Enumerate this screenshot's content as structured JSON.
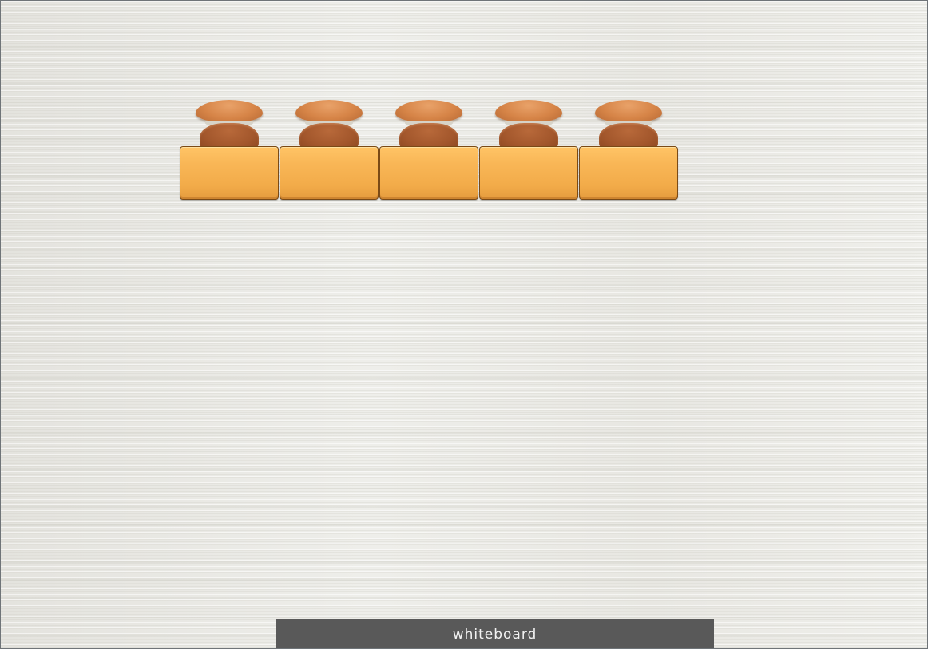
{
  "room": {
    "whiteboard_label": "whiteboard",
    "stations": [
      {
        "item": "desk-with-chair"
      },
      {
        "item": "desk-with-chair"
      },
      {
        "item": "desk-with-chair"
      },
      {
        "item": "desk-with-chair"
      },
      {
        "item": "desk-with-chair"
      }
    ]
  },
  "colors": {
    "desk": "#f9b757",
    "chair_back": "#d68447",
    "chair_seat": "#a3572c",
    "whiteboard": "#595959",
    "floor": "#e9e8e3"
  }
}
